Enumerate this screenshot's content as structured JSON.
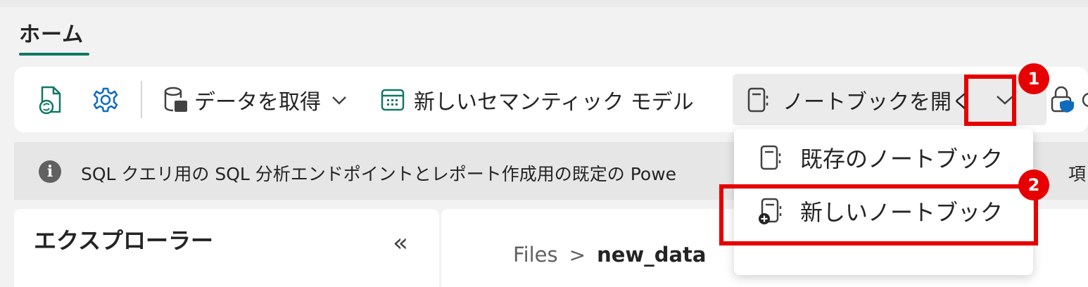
{
  "home_tab": "ホーム",
  "toolbar": {
    "get_data": "データを取得",
    "new_semantic_model": "新しいセマンティック モデル",
    "open_notebook": "ノートブックを開く"
  },
  "info_bar": {
    "text": "SQL クエリ用の SQL 分析エンドポイントとレポート作成用の既定の Powe",
    "text_right": "項目を"
  },
  "explorer": {
    "title": "エクスプローラー"
  },
  "breadcrumb": {
    "root": "Files",
    "current": "new_data"
  },
  "dropdown": {
    "items": [
      {
        "label": "既存のノートブック",
        "icon": "notebook-icon"
      },
      {
        "label": "新しいノートブック",
        "icon": "new-notebook-icon"
      }
    ]
  },
  "callouts": [
    "1",
    "2"
  ],
  "colors": {
    "accent": "#117865",
    "callout": "#e60000",
    "info_icon": "#616161"
  }
}
